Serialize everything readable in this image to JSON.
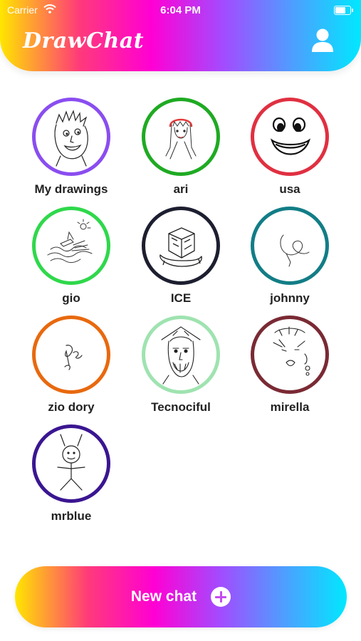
{
  "status_bar": {
    "carrier": "Carrier",
    "time": "6:04 PM"
  },
  "header": {
    "app_name": "DrawChat",
    "profile_icon": "user-icon"
  },
  "contacts": [
    {
      "name": "My drawings",
      "ring": "#8a4df0",
      "drawing": "spiky-hair-face"
    },
    {
      "name": "ari",
      "ring": "#1faa23",
      "drawing": "girl-with-bangs"
    },
    {
      "name": "usa",
      "ring": "#e03041",
      "drawing": "big-smile-face"
    },
    {
      "name": "gio",
      "ring": "#2fd84b",
      "drawing": "boat-on-waves"
    },
    {
      "name": "ICE",
      "ring": "#1d1f30",
      "drawing": "ice-cube"
    },
    {
      "name": "johnny",
      "ring": "#127d86",
      "drawing": "scribble"
    },
    {
      "name": "zio dory",
      "ring": "#e8690e",
      "drawing": "signature"
    },
    {
      "name": "Tecnociful",
      "ring": "#9fe3b0",
      "drawing": "bearded-face"
    },
    {
      "name": "mirella",
      "ring": "#7a2a34",
      "drawing": "woman-face"
    },
    {
      "name": "mrblue",
      "ring": "#3a1691",
      "drawing": "stick-figure"
    }
  ],
  "footer": {
    "new_chat_label": "New chat",
    "new_chat_icon": "plus-circle-icon"
  }
}
